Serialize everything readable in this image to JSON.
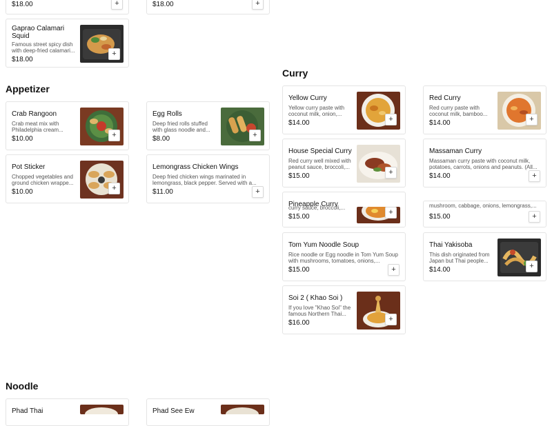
{
  "sections": {
    "appetizer": "Appetizer",
    "curry": "Curry",
    "noodle": "Noodle"
  },
  "top_partial": {
    "left": {
      "price": "$18.00"
    },
    "right": {
      "price": "$18.00"
    }
  },
  "gaprao": {
    "name": "Gaprao Calamari Squid",
    "desc": "Famous street spicy dish with deep-fried calamari...",
    "price": "$18.00"
  },
  "appetizer": [
    {
      "name": "Crab Rangoon",
      "desc": "Crab meat mix with Philadelphia cream...",
      "price": "$10.00"
    },
    {
      "name": "Egg Rolls",
      "desc": "Deep fried rolls stuffed with glass noodle and...",
      "price": "$8.00"
    },
    {
      "name": "Pot Sticker",
      "desc": "Chopped vegetables and ground chicken wrappe...",
      "price": "$10.00"
    },
    {
      "name": "Lemongrass Chicken Wings",
      "desc": "Deep fried chicken wings marinated in lemongrass, black pepper. Served with a...",
      "price": "$11.00"
    }
  ],
  "curry": [
    {
      "name": "Yellow Curry",
      "desc": "Yellow curry paste with coconut milk, onion,...",
      "price": "$14.00"
    },
    {
      "name": "Red Curry",
      "desc": "Red curry paste with coconut milk, bamboo...",
      "price": "$14.00"
    },
    {
      "name": "House Special Curry",
      "desc": "Red curry well mixed with peanut sauce, broccoli,...",
      "price": "$15.00"
    },
    {
      "name": "Massaman Curry",
      "desc": "Massaman curry paste with coconut milk, potatoes, carrots, onions and peanuts. (All...",
      "price": "$14.00"
    },
    {
      "name": "Pineapple Curry",
      "desc": "curry sauce, broccoli,...",
      "price": "$15.00"
    },
    {
      "name": "",
      "desc": "mushroom, cabbage, onions, lemongrass,...",
      "price": "$15.00"
    },
    {
      "name": "Tom Yum Noodle Soup",
      "desc": "Rice noodle or Egg noodle in Tom Yum Soup with mushrooms, tomatoes, onions,...",
      "price": "$15.00"
    },
    {
      "name": "Thai Yakisoba",
      "desc": "This dish originated from Japan but Thai people...",
      "price": "$14.00"
    },
    {
      "name": "Soi 2 ( Khao Soi )",
      "desc": "If you love \"Khao Soi\" the famous Northern Thai...",
      "price": "$16.00"
    }
  ],
  "noodle": [
    {
      "name": "Phad Thai"
    },
    {
      "name": "Phad See Ew"
    }
  ],
  "add_symbol": "+",
  "icons": {
    "add": "plus-icon",
    "food": "food-photo"
  },
  "colors": {
    "wood": "#6b2f1a",
    "card_border": "#e4e4e4",
    "text": "#111111",
    "muted": "#555555"
  }
}
